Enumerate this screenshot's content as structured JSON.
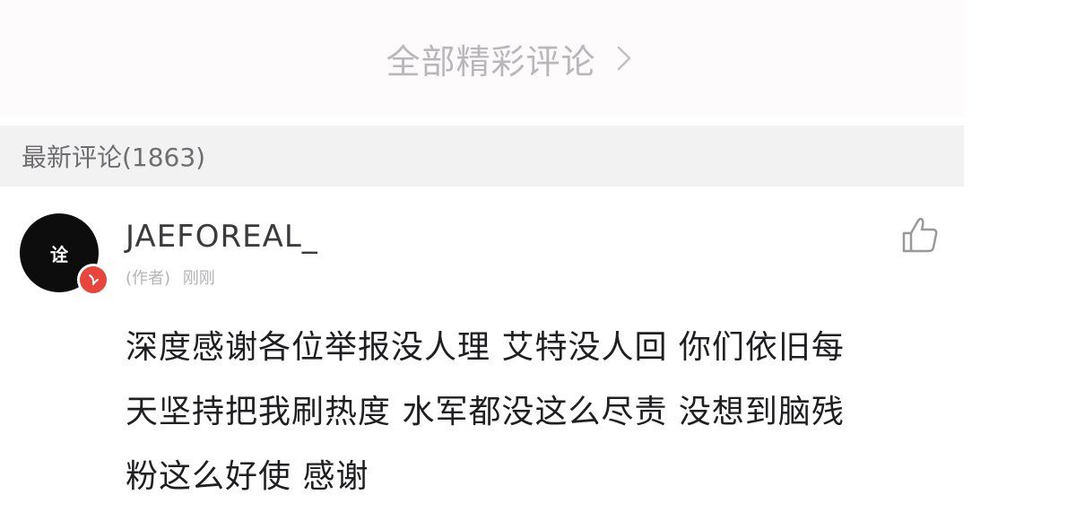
{
  "all_comments": {
    "label": "全部精彩评论",
    "icon": "chevron-right-icon"
  },
  "latest_section": {
    "title": "最新评论(1863)"
  },
  "comment": {
    "avatar_text": "诠",
    "username": "JAEFOREAL_",
    "author_tag": "(作者)",
    "time": "刚刚",
    "like_icon": "thumbs-up-icon",
    "lines": [
      "深度感谢各位举报没人理 艾特没人回 你们依旧每",
      "天坚持把我刷热度 水军都没这么尽责 没想到脑残",
      "粉这么好使 感谢"
    ]
  },
  "colors": {
    "badge": "#e8463c",
    "avatar_bg": "#0d0d0e",
    "header_bg": "#f3f2f3",
    "muted_text": "#b9b7ba"
  }
}
